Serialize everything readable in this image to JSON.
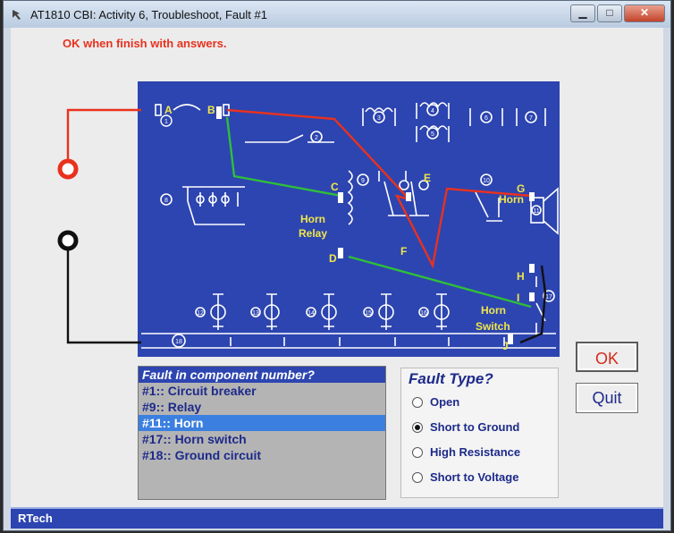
{
  "window": {
    "title": "AT1810 CBI: Activity 6, Troubleshoot, Fault #1",
    "minimize": "▁",
    "maximize": "□",
    "close": "✕"
  },
  "instruction": "OK when finish with answers.",
  "diagram": {
    "points": {
      "a": "A",
      "b": "B",
      "c": "C",
      "d": "D",
      "e": "E",
      "f": "F",
      "g": "G",
      "h": "H",
      "i": "I",
      "j": "J"
    },
    "labels": {
      "horn_relay_1": "Horn",
      "horn_relay_2": "Relay",
      "horn": "Horn",
      "horn_switch_1": "Horn",
      "horn_switch_2": "Switch"
    },
    "component_numbers": [
      "1",
      "2",
      "3",
      "4",
      "5",
      "6",
      "7",
      "8",
      "9",
      "10",
      "11",
      "12",
      "13",
      "14",
      "15",
      "16",
      "17",
      "18"
    ],
    "colors": {
      "board": "#2d45b0",
      "hot_wire": "#e8321e",
      "ground_wire": "#111111",
      "control_wire": "#2fbf3a",
      "fault_wire": "#e8321e",
      "component": "#ffffff",
      "label": "#f0e64a"
    }
  },
  "buttons": {
    "ok": "OK",
    "quit": "Quit"
  },
  "fault_list": {
    "header": "Fault in component number?",
    "items": [
      {
        "label": "#1:: Circuit breaker"
      },
      {
        "label": "#9:: Relay"
      },
      {
        "label": "#11:: Horn"
      },
      {
        "label": "#17:: Horn switch"
      },
      {
        "label": "#18:: Ground circuit"
      }
    ],
    "selected_index": 2
  },
  "fault_type": {
    "title": "Fault Type?",
    "options": [
      "Open",
      "Short to Ground",
      "High Resistance",
      "Short to Voltage"
    ],
    "selected_index": 1
  },
  "status": "RTech"
}
